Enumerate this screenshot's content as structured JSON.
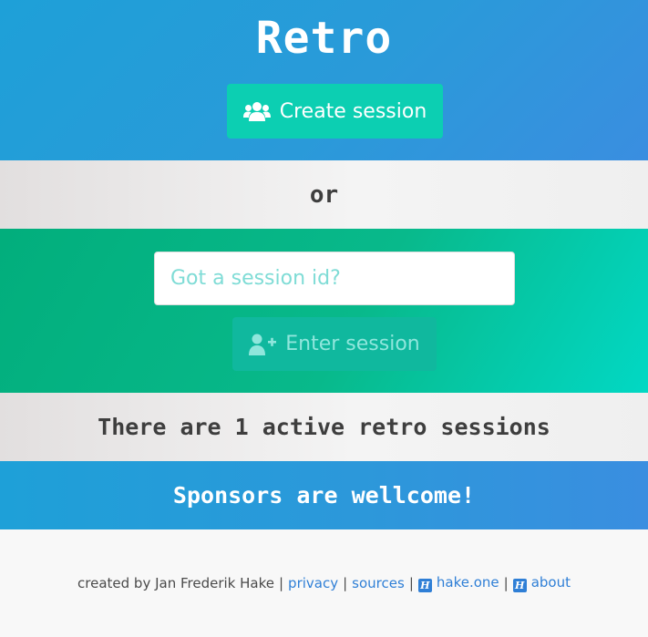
{
  "header": {
    "title": "Retro",
    "create_button": {
      "label": "Create session",
      "icon": "users-icon"
    }
  },
  "divider": {
    "or_text": "or"
  },
  "join": {
    "input": {
      "placeholder": "Got a session id?",
      "value": ""
    },
    "enter_button": {
      "label": "Enter session",
      "icon": "user-plus-icon"
    }
  },
  "stats": {
    "active_sessions_text": "There are 1 active retro sessions"
  },
  "sponsors": {
    "text": "Sponsors are wellcome!"
  },
  "footer": {
    "created_by": "created by Jan Frederik Hake",
    "separator": "|",
    "links": {
      "privacy": "privacy",
      "sources": "sources",
      "hake_one": "hake.one",
      "about": "about"
    },
    "link_icon": "hake-logo-icon",
    "link_icon_glyph": "H"
  },
  "colors": {
    "header_blue": "#2a9ad9",
    "teal_button": "#0ccfb2",
    "green_band": "#08b98b",
    "link_blue": "#2f7fd6"
  }
}
